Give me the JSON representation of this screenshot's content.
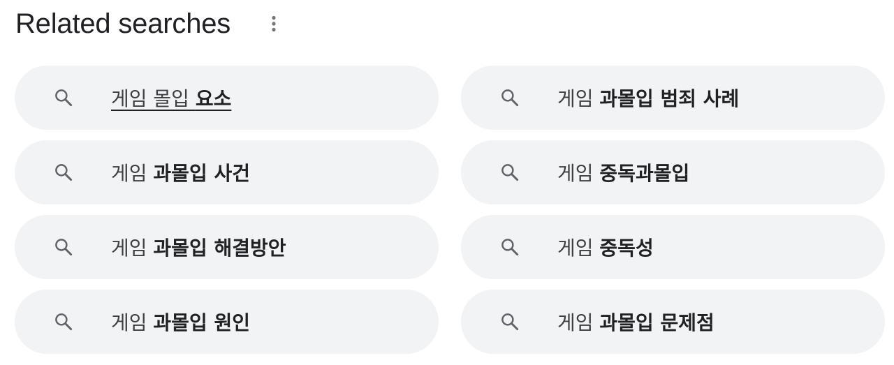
{
  "header": {
    "title": "Related searches",
    "more_icon": "more-vert-icon"
  },
  "icons": {
    "search": "search-icon"
  },
  "colors": {
    "chip_background": "#f1f3f4",
    "text": "#202124",
    "icon": "#5f6368"
  },
  "searches": [
    {
      "plain": "게임 몰입 ",
      "bold": "요소",
      "underlined": true
    },
    {
      "plain": "게임 ",
      "bold": "과몰입 범죄 사례",
      "underlined": false
    },
    {
      "plain": "게임 ",
      "bold": "과몰입 사건",
      "underlined": false
    },
    {
      "plain": "게임 ",
      "bold": "중독과몰입",
      "underlined": false
    },
    {
      "plain": "게임 ",
      "bold": "과몰입 해결방안",
      "underlined": false
    },
    {
      "plain": "게임 ",
      "bold": "중독성",
      "underlined": false
    },
    {
      "plain": "게임 ",
      "bold": "과몰입 원인",
      "underlined": false
    },
    {
      "plain": "게임 ",
      "bold": "과몰입 문제점",
      "underlined": false
    }
  ]
}
